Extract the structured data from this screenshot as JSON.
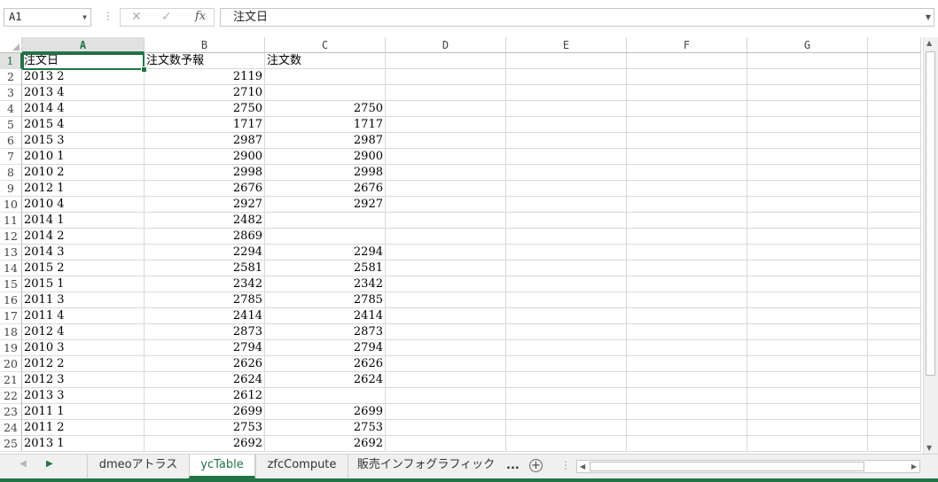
{
  "formula_bar": {
    "name_box": "A1",
    "formula": "注文日",
    "fx_label": "fx",
    "cancel_glyph": "✕",
    "enter_glyph": "✓"
  },
  "columns": [
    "A",
    "B",
    "C",
    "D",
    "E",
    "F",
    "G"
  ],
  "rows": [
    {
      "n": "1",
      "a": "注文日",
      "b": "注文数予報",
      "c": "注文数"
    },
    {
      "n": "2",
      "a": "2013 2",
      "b": "2119",
      "c": ""
    },
    {
      "n": "3",
      "a": "2013 4",
      "b": "2710",
      "c": ""
    },
    {
      "n": "4",
      "a": "2014 4",
      "b": "2750",
      "c": "2750"
    },
    {
      "n": "5",
      "a": "2015 4",
      "b": "1717",
      "c": "1717"
    },
    {
      "n": "6",
      "a": "2015 3",
      "b": "2987",
      "c": "2987"
    },
    {
      "n": "7",
      "a": "2010 1",
      "b": "2900",
      "c": "2900"
    },
    {
      "n": "8",
      "a": "2010 2",
      "b": "2998",
      "c": "2998"
    },
    {
      "n": "9",
      "a": "2012 1",
      "b": "2676",
      "c": "2676"
    },
    {
      "n": "10",
      "a": "2010 4",
      "b": "2927",
      "c": "2927"
    },
    {
      "n": "11",
      "a": "2014 1",
      "b": "2482",
      "c": ""
    },
    {
      "n": "12",
      "a": "2014 2",
      "b": "2869",
      "c": ""
    },
    {
      "n": "13",
      "a": "2014 3",
      "b": "2294",
      "c": "2294"
    },
    {
      "n": "14",
      "a": "2015 2",
      "b": "2581",
      "c": "2581"
    },
    {
      "n": "15",
      "a": "2015 1",
      "b": "2342",
      "c": "2342"
    },
    {
      "n": "16",
      "a": "2011 3",
      "b": "2785",
      "c": "2785"
    },
    {
      "n": "17",
      "a": "2011 4",
      "b": "2414",
      "c": "2414"
    },
    {
      "n": "18",
      "a": "2012 4",
      "b": "2873",
      "c": "2873"
    },
    {
      "n": "19",
      "a": "2010 3",
      "b": "2794",
      "c": "2794"
    },
    {
      "n": "20",
      "a": "2012 2",
      "b": "2626",
      "c": "2626"
    },
    {
      "n": "21",
      "a": "2012 3",
      "b": "2624",
      "c": "2624"
    },
    {
      "n": "22",
      "a": "2013 3",
      "b": "2612",
      "c": ""
    },
    {
      "n": "23",
      "a": "2011 1",
      "b": "2699",
      "c": "2699"
    },
    {
      "n": "24",
      "a": "2011 2",
      "b": "2753",
      "c": "2753"
    },
    {
      "n": "25",
      "a": "2013 1",
      "b": "2692",
      "c": "2692"
    }
  ],
  "sheets": [
    {
      "label": "dmeoアトラス",
      "active": false
    },
    {
      "label": "ycTable",
      "active": true
    },
    {
      "label": "zfcCompute",
      "active": false
    },
    {
      "label": "販売インフォグラフィック",
      "active": false
    }
  ],
  "tabbar": {
    "more_label": "...",
    "add_glyph": "+",
    "separator": "⋮"
  },
  "colors": {
    "accent": "#217346",
    "gridline": "#d9d9d9",
    "header_active_bg": "#e1e1e1"
  }
}
